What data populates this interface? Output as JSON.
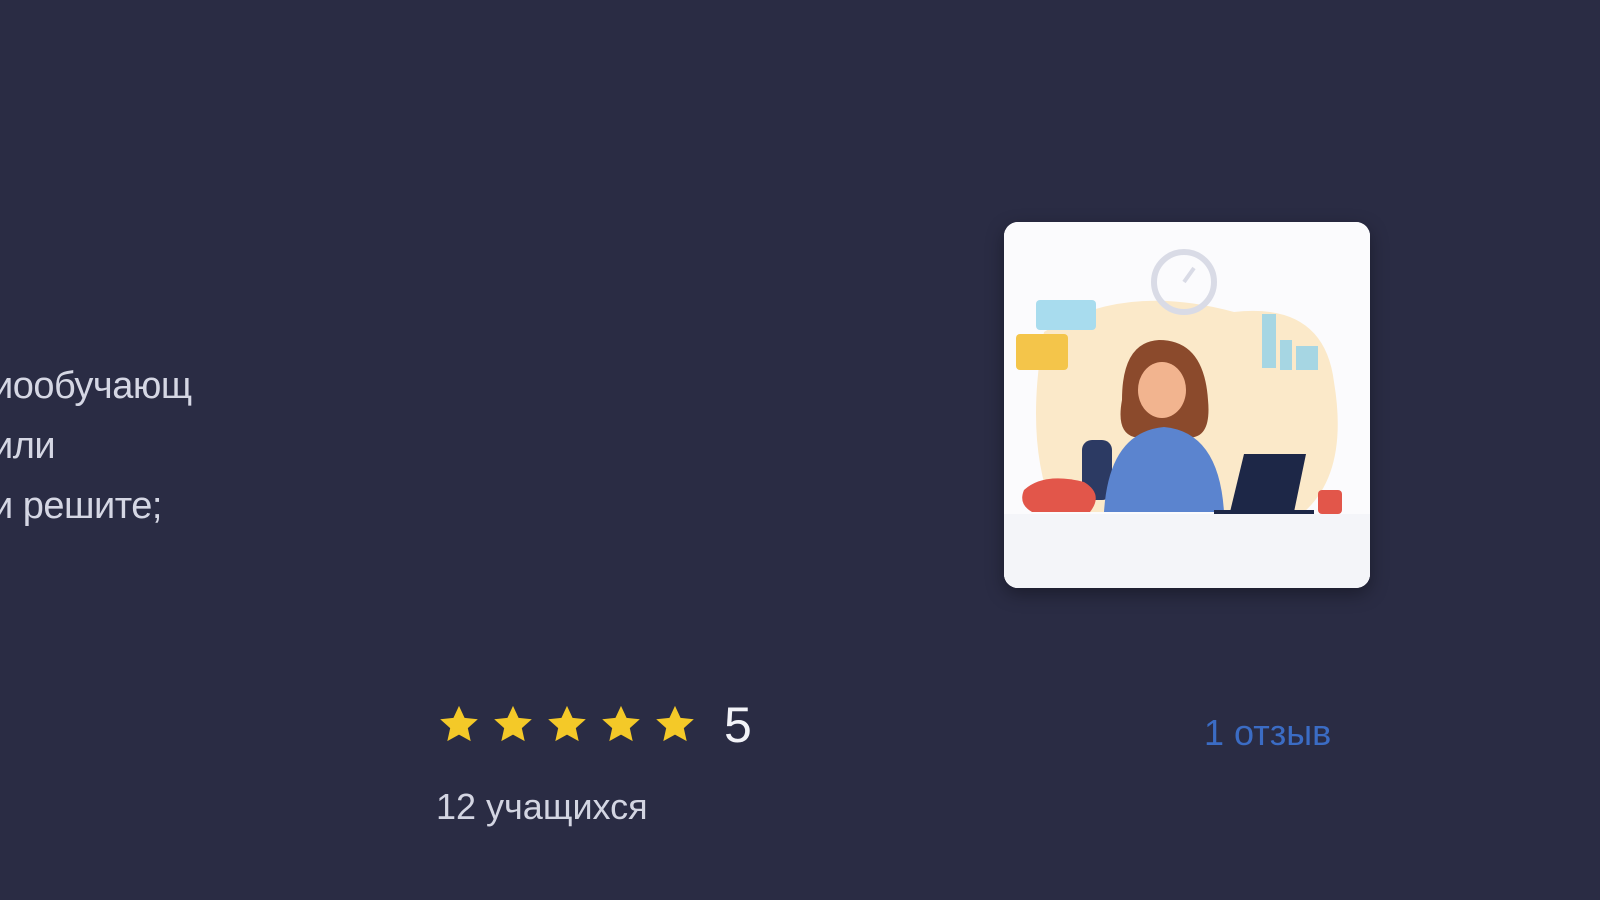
{
  "description": {
    "lines": [
      "иообучающ",
      "или",
      "и решите;"
    ]
  },
  "course_card": {
    "image": "woman-at-laptop-illustration"
  },
  "rating": {
    "stars_filled": 5,
    "stars_total": 5,
    "score": "5",
    "star_color": "#f4c928"
  },
  "students": {
    "label": "12 учащихся"
  },
  "reviews": {
    "link": "1 отзыв",
    "link_color": "#3b6cc4"
  },
  "colors": {
    "background": "#2a2c44"
  }
}
